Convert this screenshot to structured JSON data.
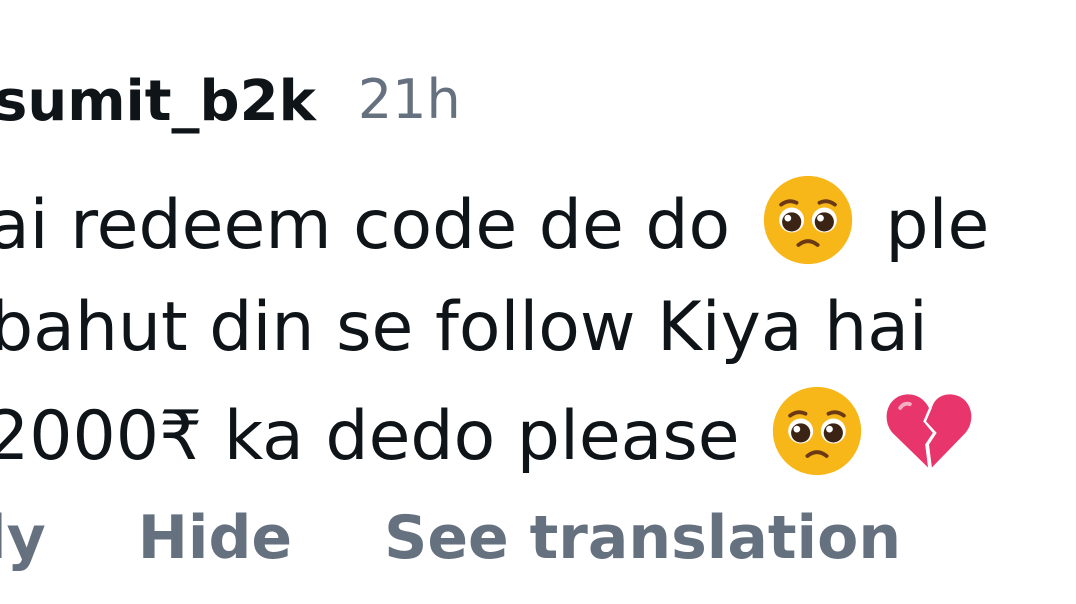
{
  "comment": {
    "username": "sumit_b2k",
    "timestamp": "21h",
    "lines": [
      {
        "before": "ai redeem code de do",
        "after": "ple"
      },
      {
        "before": "bahut din se follow Kiya hai",
        "after": ""
      },
      {
        "before": "2000₹ ka dedo please",
        "after": ""
      }
    ],
    "emojis": [
      "pleading-face",
      "pleading-face",
      "broken-heart"
    ]
  },
  "actions": {
    "reply_label": "ly",
    "hide_label": "Hide",
    "translate_label": "See translation"
  },
  "colors": {
    "text": "#0f1419",
    "muted": "#667180",
    "emoji_face": "#f7b718",
    "heart": "#e8356b"
  }
}
